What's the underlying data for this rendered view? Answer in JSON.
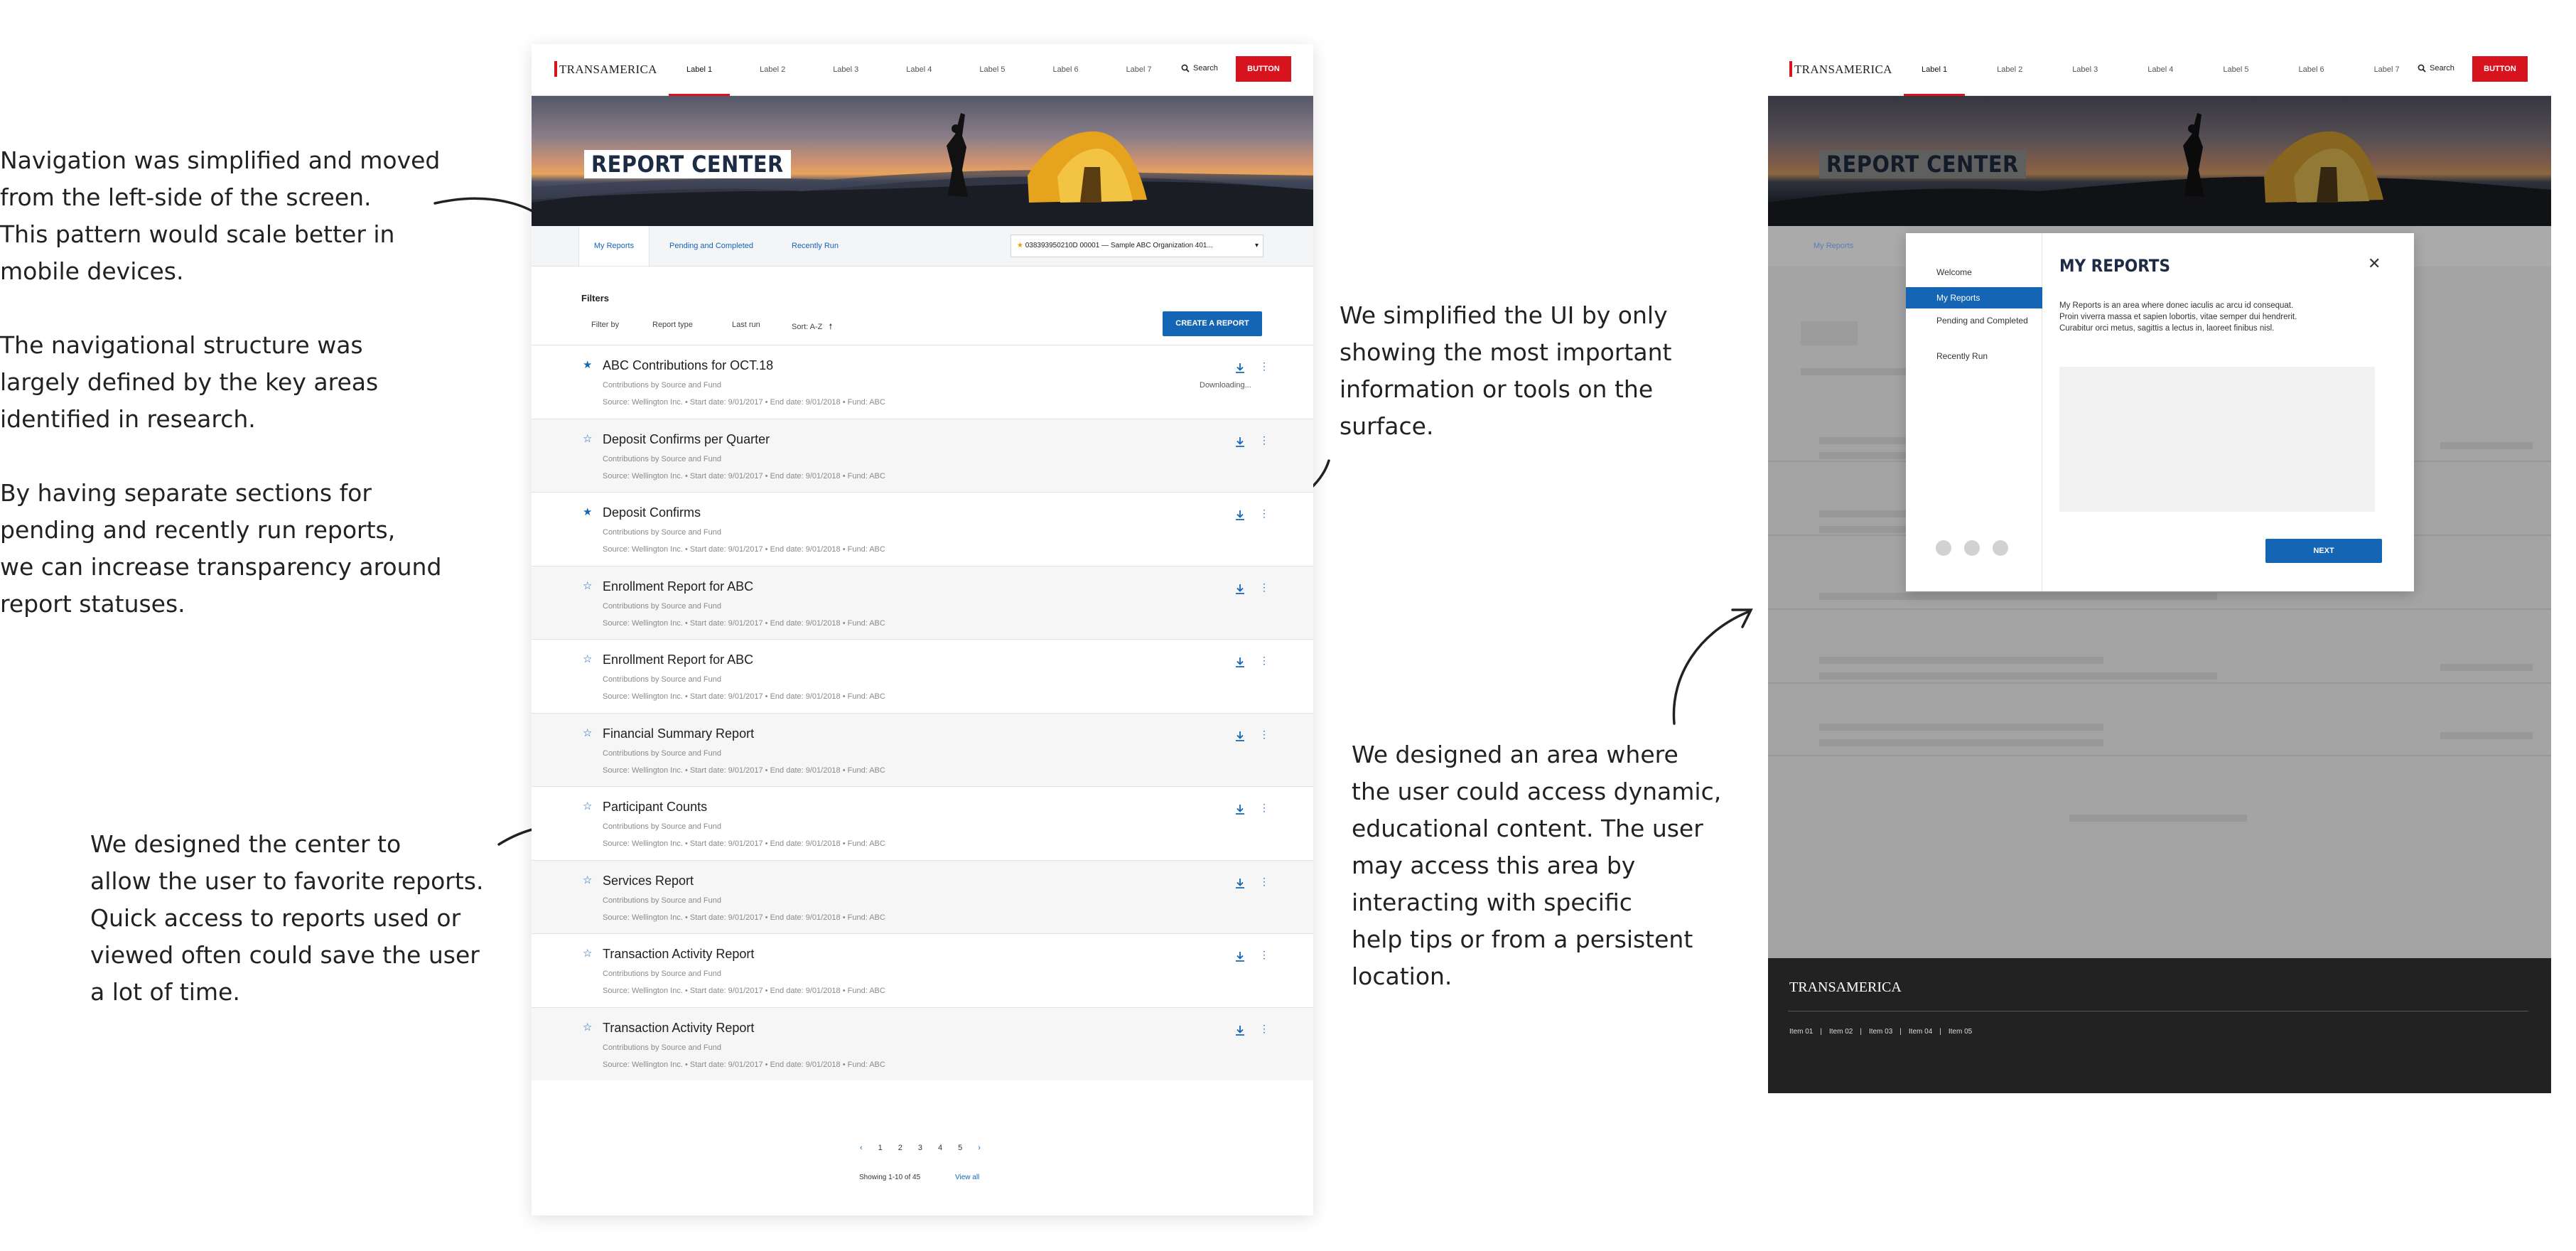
{
  "annotations": {
    "navigation": [
      [
        "Navigation was simplified and moved",
        "from the left-side of the screen.",
        "This pattern would scale better in",
        "mobile devices."
      ],
      [
        "The navigational structure was",
        "largely defined by the key areas",
        "identified in research."
      ],
      [
        "By having separate sections for",
        "pending and recently run reports,",
        "we can increase transparency around",
        "report statuses."
      ]
    ],
    "favorites": [
      "We designed the center to",
      "allow the user to favorite reports.",
      "Quick access to reports used or",
      "viewed often could save the user",
      "a lot of time."
    ],
    "simplified": [
      "We simplified the UI by only",
      "showing the most important",
      "information or tools on the",
      "surface."
    ],
    "educational": [
      "We designed an area where",
      "the user could access dynamic,",
      "educational content. The user",
      "may access this area by",
      "interacting with specific",
      "help tips or from a persistent",
      "location."
    ]
  },
  "header": {
    "logo": "TRANSAMERICA",
    "nav_labels": [
      "Label 1",
      "Label 2",
      "Label 3",
      "Label 4",
      "Label 5",
      "Label 6",
      "Label 7"
    ],
    "search_label": "Search",
    "button_label": "BUTTON"
  },
  "hero": {
    "title": "REPORT CENTER"
  },
  "tabs": [
    "My Reports",
    "Pending and Completed",
    "Recently Run"
  ],
  "org_selector": {
    "value": "038393950210D 00001 — Sample ABC Organization 401..."
  },
  "filters": {
    "heading": "Filters",
    "options": [
      "Filter by",
      "Report type",
      "Last run",
      "Sort: A-Z"
    ],
    "create_button": "CREATE A REPORT"
  },
  "reports": [
    {
      "title": "ABC Contributions for OCT.18",
      "favorite": true,
      "status": "Downloading..."
    },
    {
      "title": "Deposit Confirms per Quarter",
      "favorite": false,
      "status": ""
    },
    {
      "title": "Deposit Confirms",
      "favorite": true,
      "status": ""
    },
    {
      "title": "Enrollment Report for ABC",
      "favorite": false,
      "status": ""
    },
    {
      "title": "Enrollment Report for ABC",
      "favorite": false,
      "status": ""
    },
    {
      "title": "Financial Summary Report",
      "favorite": false,
      "status": ""
    },
    {
      "title": "Participant Counts",
      "favorite": false,
      "status": ""
    },
    {
      "title": "Services Report",
      "favorite": false,
      "status": ""
    },
    {
      "title": "Transaction Activity Report",
      "favorite": false,
      "status": ""
    },
    {
      "title": "Transaction Activity Report",
      "favorite": false,
      "status": ""
    }
  ],
  "report_row": {
    "subtitle": "Contributions by Source and Fund",
    "meta": [
      "Source: Wellington Inc.",
      "Start date: 9/01/2017",
      "End date: 9/01/2018",
      "Fund: ABC"
    ]
  },
  "pagination": {
    "pages": [
      "1",
      "2",
      "3",
      "4",
      "5"
    ],
    "showing": "Showing 1-10 of 45",
    "view_all": "View all"
  },
  "modal": {
    "nav": [
      "Welcome",
      "My Reports",
      "Pending and Completed",
      "Recently Run"
    ],
    "active_index": 1,
    "title": "MY REPORTS",
    "body": [
      "My Reports is an area where donec iaculis ac arcu id consequat.",
      "Proin viverra massa et sapien lobortis, vitae semper dui hendrerit.",
      "Curabitur orci metus, sagittis a lectus in, laoreet finibus nisl."
    ],
    "next_button": "NEXT"
  },
  "background_tab": "My Reports",
  "footer": {
    "logo": "TRANSAMERICA",
    "items": [
      "Item 01",
      "Item 02",
      "Item 03",
      "Item 04",
      "Item 05"
    ]
  },
  "colors": {
    "brand_red": "#d7141e",
    "brand_blue": "#1565b5",
    "footer_dark": "#222222"
  }
}
